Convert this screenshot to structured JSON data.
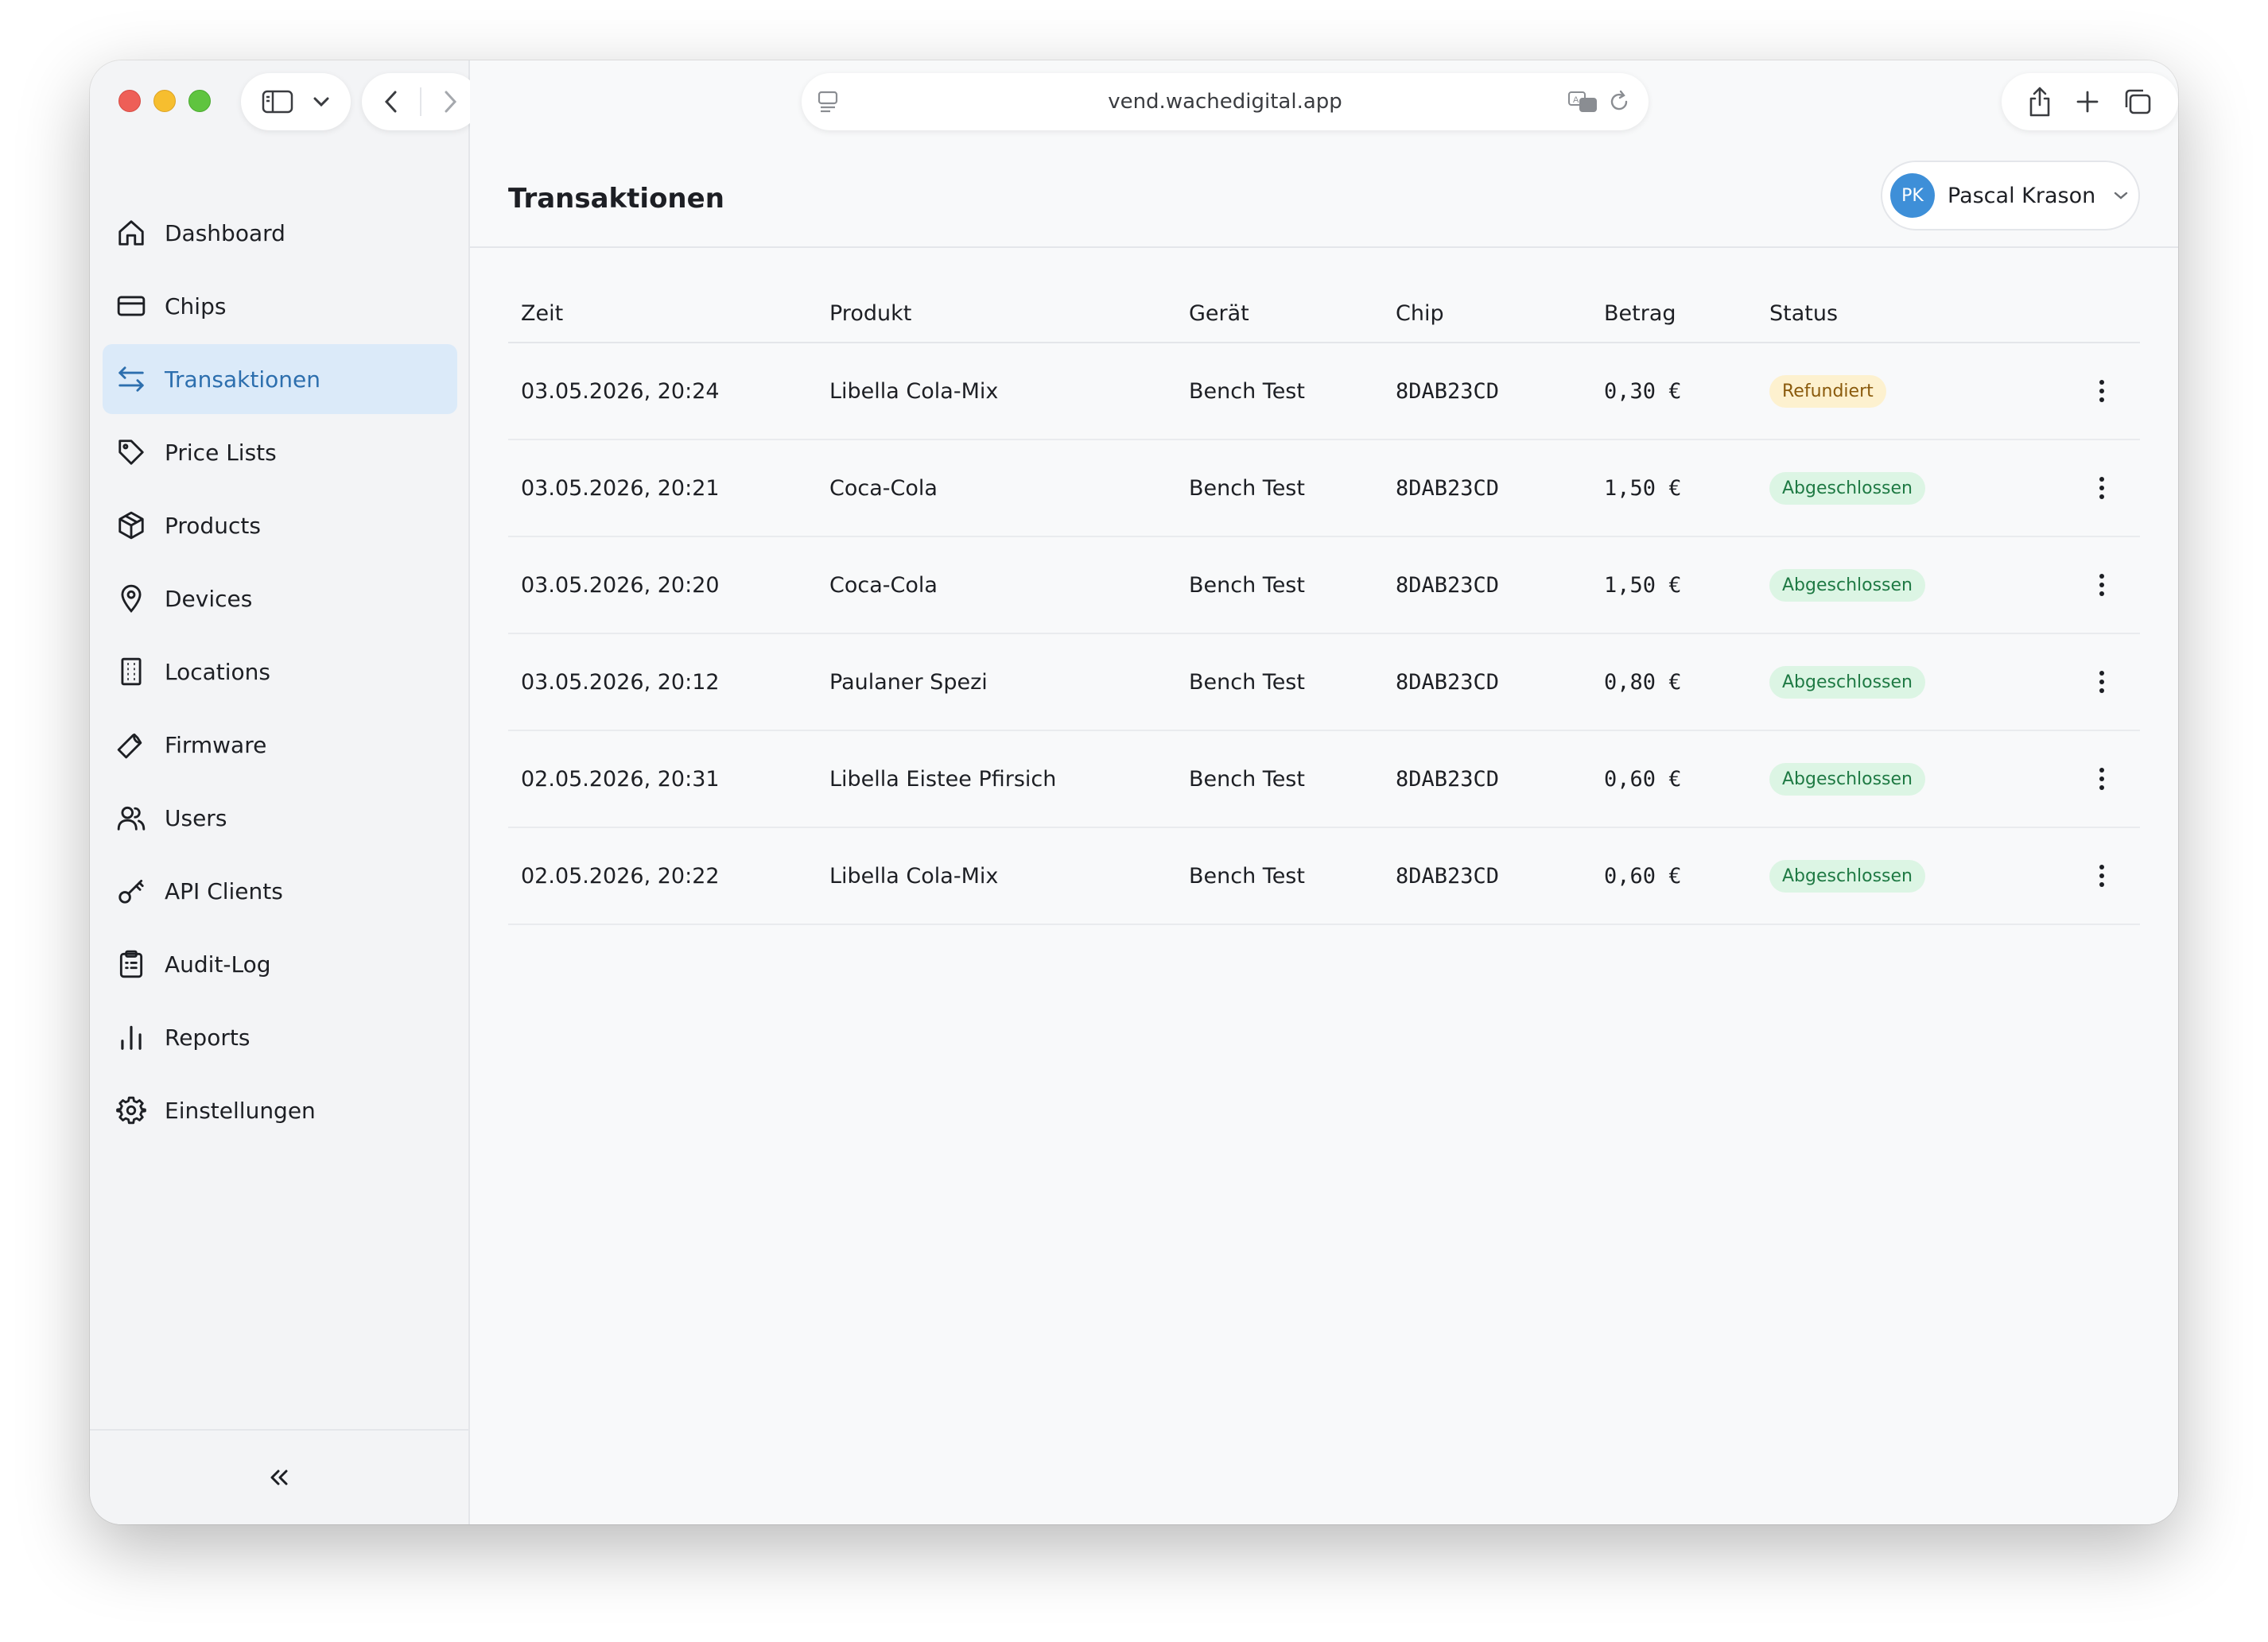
{
  "browser": {
    "url": "vend.wachedigital.app"
  },
  "sidebar": {
    "items": [
      {
        "label": "Dashboard",
        "icon": "home-icon"
      },
      {
        "label": "Chips",
        "icon": "card-icon"
      },
      {
        "label": "Transaktionen",
        "icon": "arrows-exchange-icon",
        "active": true
      },
      {
        "label": "Price Lists",
        "icon": "tag-icon"
      },
      {
        "label": "Products",
        "icon": "box-icon"
      },
      {
        "label": "Devices",
        "icon": "map-pin-icon"
      },
      {
        "label": "Locations",
        "icon": "building-icon"
      },
      {
        "label": "Firmware",
        "icon": "wrench-icon"
      },
      {
        "label": "Users",
        "icon": "users-icon"
      },
      {
        "label": "API Clients",
        "icon": "key-icon"
      },
      {
        "label": "Audit-Log",
        "icon": "clipboard-icon"
      },
      {
        "label": "Reports",
        "icon": "bar-chart-icon"
      },
      {
        "label": "Einstellungen",
        "icon": "gear-icon"
      }
    ],
    "collapse_icon": "chevrons-left-icon"
  },
  "header": {
    "title": "Transaktionen",
    "user": {
      "initials": "PK",
      "name": "Pascal Krason"
    }
  },
  "table": {
    "columns": [
      "Zeit",
      "Produkt",
      "Gerät",
      "Chip",
      "Betrag",
      "Status"
    ],
    "rows": [
      {
        "zeit": "03.05.2026, 20:24",
        "produkt": "Libella Cola-Mix",
        "geraet": "Bench Test",
        "chip": "8DAB23CD",
        "betrag": "0,30 €",
        "status": "Refundiert",
        "status_type": "refund"
      },
      {
        "zeit": "03.05.2026, 20:21",
        "produkt": "Coca-Cola",
        "geraet": "Bench Test",
        "chip": "8DAB23CD",
        "betrag": "1,50 €",
        "status": "Abgeschlossen",
        "status_type": "done"
      },
      {
        "zeit": "03.05.2026, 20:20",
        "produkt": "Coca-Cola",
        "geraet": "Bench Test",
        "chip": "8DAB23CD",
        "betrag": "1,50 €",
        "status": "Abgeschlossen",
        "status_type": "done"
      },
      {
        "zeit": "03.05.2026, 20:12",
        "produkt": "Paulaner Spezi",
        "geraet": "Bench Test",
        "chip": "8DAB23CD",
        "betrag": "0,80 €",
        "status": "Abgeschlossen",
        "status_type": "done"
      },
      {
        "zeit": "02.05.2026, 20:31",
        "produkt": "Libella Eistee Pfirsich",
        "geraet": "Bench Test",
        "chip": "8DAB23CD",
        "betrag": "0,60 €",
        "status": "Abgeschlossen",
        "status_type": "done"
      },
      {
        "zeit": "02.05.2026, 20:22",
        "produkt": "Libella Cola-Mix",
        "geraet": "Bench Test",
        "chip": "8DAB23CD",
        "betrag": "0,60 €",
        "status": "Abgeschlossen",
        "status_type": "done"
      }
    ]
  },
  "colors": {
    "accent": "#2d6fae",
    "active_bg": "#dbeaf9",
    "avatar": "#3e8fd8",
    "badge_refund_bg": "#fdf1cf",
    "badge_done_bg": "#dcf5e4"
  }
}
